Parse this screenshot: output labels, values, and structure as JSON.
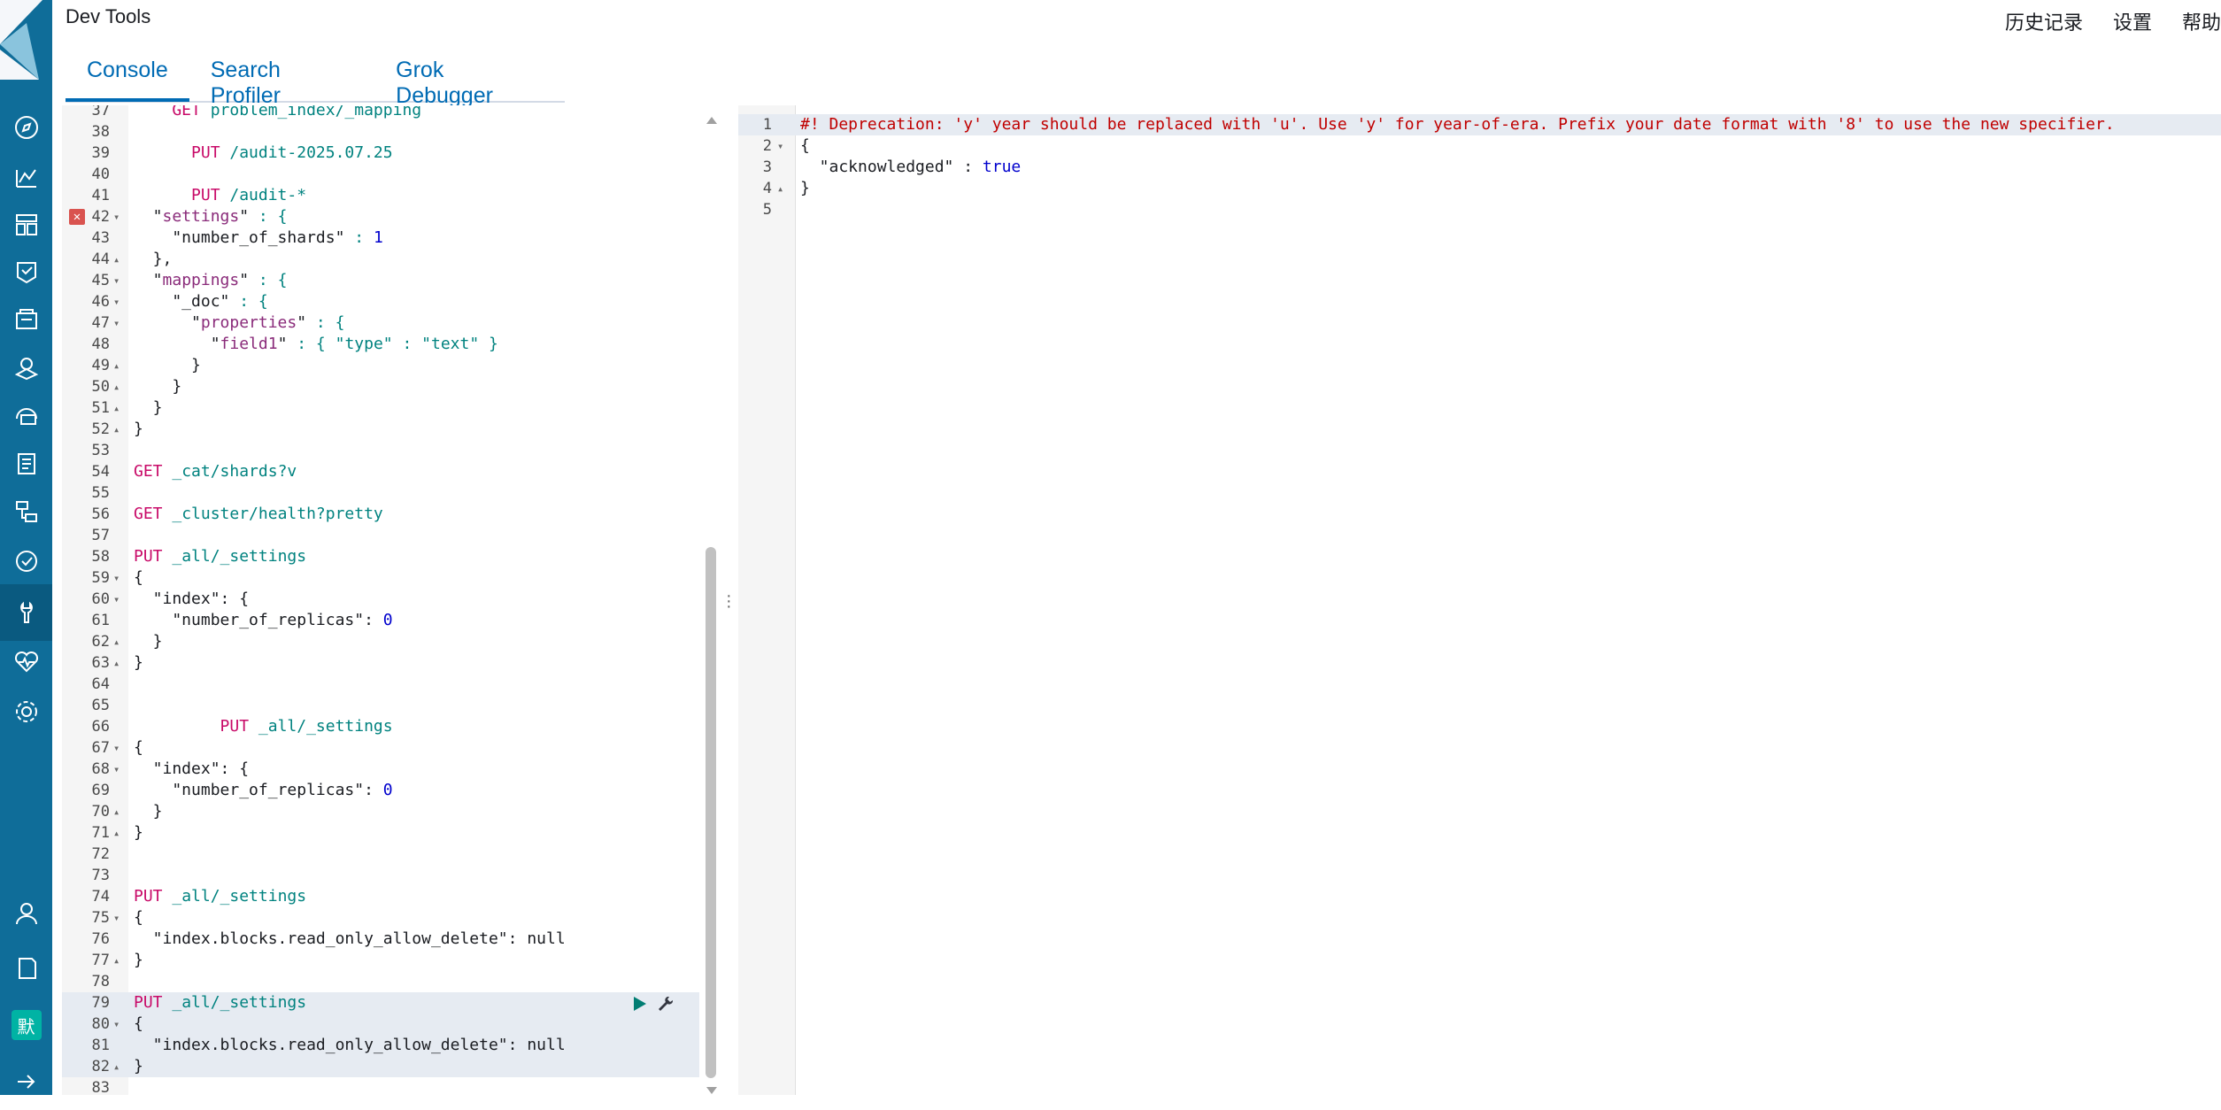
{
  "header": {
    "title": "Dev Tools",
    "links": [
      "历史记录",
      "设置",
      "帮助"
    ]
  },
  "tabs": [
    {
      "label": "Console",
      "active": true
    },
    {
      "label": "Search Profiler",
      "active": false
    },
    {
      "label": "Grok Debugger",
      "active": false
    }
  ],
  "sidebar": {
    "items": [
      "compass",
      "visualize",
      "dashboard",
      "canvas",
      "maps",
      "ml",
      "infrastructure",
      "logs",
      "apm",
      "uptime",
      "dev-tools",
      "monitoring",
      "management"
    ],
    "user_badge": "默"
  },
  "editor": {
    "lines": [
      {
        "n": "37",
        "fold": "",
        "t": [
          [
            "m",
            "    GET "
          ],
          [
            "u",
            "problem_index/_mapping"
          ]
        ]
      },
      {
        "n": "38",
        "fold": "",
        "t": []
      },
      {
        "n": "39",
        "fold": "",
        "t": [
          [
            "m",
            "      PUT "
          ],
          [
            "u",
            "/audit-2025.07.25"
          ]
        ]
      },
      {
        "n": "40",
        "fold": "",
        "t": []
      },
      {
        "n": "41",
        "fold": "",
        "t": [
          [
            "m",
            "      PUT "
          ],
          [
            "u",
            "/audit-*"
          ]
        ]
      },
      {
        "n": "42",
        "fold": "▾",
        "err": true,
        "t": [
          [
            "b",
            "  \""
          ],
          [
            "k",
            "settings"
          ],
          [
            "b",
            "\""
          ],
          [
            "s",
            " : {"
          ]
        ]
      },
      {
        "n": "43",
        "fold": "",
        "t": [
          [
            "b",
            "    \"number_of_shards\""
          ],
          [
            "s",
            " : "
          ],
          [
            "n",
            "1"
          ]
        ]
      },
      {
        "n": "44",
        "fold": "▴",
        "t": [
          [
            "b",
            "  },"
          ]
        ]
      },
      {
        "n": "45",
        "fold": "▾",
        "t": [
          [
            "b",
            "  \""
          ],
          [
            "k",
            "mappings"
          ],
          [
            "b",
            "\""
          ],
          [
            "s",
            " : {"
          ]
        ]
      },
      {
        "n": "46",
        "fold": "▾",
        "t": [
          [
            "b",
            "    \"_doc\""
          ],
          [
            "s",
            " : {"
          ]
        ]
      },
      {
        "n": "47",
        "fold": "▾",
        "t": [
          [
            "b",
            "      \""
          ],
          [
            "k",
            "properties"
          ],
          [
            "b",
            "\""
          ],
          [
            "s",
            " : {"
          ]
        ]
      },
      {
        "n": "48",
        "fold": "",
        "t": [
          [
            "b",
            "        \""
          ],
          [
            "k",
            "field1"
          ],
          [
            "b",
            "\""
          ],
          [
            "s",
            " : { \"type\" : \"text\" }"
          ]
        ]
      },
      {
        "n": "49",
        "fold": "▴",
        "t": [
          [
            "b",
            "      }"
          ]
        ]
      },
      {
        "n": "50",
        "fold": "▴",
        "t": [
          [
            "b",
            "    }"
          ]
        ]
      },
      {
        "n": "51",
        "fold": "▴",
        "t": [
          [
            "b",
            "  }"
          ]
        ]
      },
      {
        "n": "52",
        "fold": "▴",
        "t": [
          [
            "b",
            "}"
          ]
        ]
      },
      {
        "n": "53",
        "fold": "",
        "t": []
      },
      {
        "n": "54",
        "fold": "",
        "t": [
          [
            "m",
            "GET "
          ],
          [
            "u",
            "_cat/shards?v"
          ]
        ]
      },
      {
        "n": "55",
        "fold": "",
        "t": []
      },
      {
        "n": "56",
        "fold": "",
        "t": [
          [
            "m",
            "GET "
          ],
          [
            "u",
            "_cluster/health?pretty"
          ]
        ]
      },
      {
        "n": "57",
        "fold": "",
        "t": []
      },
      {
        "n": "58",
        "fold": "",
        "t": [
          [
            "m",
            "PUT "
          ],
          [
            "u",
            "_all/_settings"
          ]
        ]
      },
      {
        "n": "59",
        "fold": "▾",
        "t": [
          [
            "b",
            "{"
          ]
        ]
      },
      {
        "n": "60",
        "fold": "▾",
        "t": [
          [
            "b",
            "  \"index\": {"
          ]
        ]
      },
      {
        "n": "61",
        "fold": "",
        "t": [
          [
            "b",
            "    \"number_of_replicas\": "
          ],
          [
            "n",
            "0"
          ]
        ]
      },
      {
        "n": "62",
        "fold": "▴",
        "t": [
          [
            "b",
            "  }"
          ]
        ]
      },
      {
        "n": "63",
        "fold": "▴",
        "t": [
          [
            "b",
            "}"
          ]
        ]
      },
      {
        "n": "64",
        "fold": "",
        "t": []
      },
      {
        "n": "65",
        "fold": "",
        "t": []
      },
      {
        "n": "66",
        "fold": "",
        "t": [
          [
            "m",
            "         PUT "
          ],
          [
            "u",
            "_all/_settings"
          ]
        ]
      },
      {
        "n": "67",
        "fold": "▾",
        "t": [
          [
            "b",
            "{"
          ]
        ]
      },
      {
        "n": "68",
        "fold": "▾",
        "t": [
          [
            "b",
            "  \"index\": {"
          ]
        ]
      },
      {
        "n": "69",
        "fold": "",
        "t": [
          [
            "b",
            "    \"number_of_replicas\": "
          ],
          [
            "n",
            "0"
          ]
        ]
      },
      {
        "n": "70",
        "fold": "▴",
        "t": [
          [
            "b",
            "  }"
          ]
        ]
      },
      {
        "n": "71",
        "fold": "▴",
        "t": [
          [
            "b",
            "}"
          ]
        ]
      },
      {
        "n": "72",
        "fold": "",
        "t": []
      },
      {
        "n": "73",
        "fold": "",
        "t": []
      },
      {
        "n": "74",
        "fold": "",
        "t": [
          [
            "m",
            "PUT "
          ],
          [
            "u",
            "_all/_settings"
          ]
        ]
      },
      {
        "n": "75",
        "fold": "▾",
        "t": [
          [
            "b",
            "{"
          ]
        ]
      },
      {
        "n": "76",
        "fold": "",
        "t": [
          [
            "b",
            "  \"index.blocks.read_only_allow_delete\": null"
          ]
        ]
      },
      {
        "n": "77",
        "fold": "▴",
        "t": [
          [
            "b",
            "}"
          ]
        ]
      },
      {
        "n": "78",
        "fold": "",
        "t": []
      },
      {
        "n": "79",
        "fold": "",
        "hl": true,
        "actions": true,
        "t": [
          [
            "m",
            "PUT "
          ],
          [
            "u",
            "_all/_settings"
          ]
        ]
      },
      {
        "n": "80",
        "fold": "▾",
        "hl": true,
        "t": [
          [
            "b",
            "{"
          ]
        ]
      },
      {
        "n": "81",
        "fold": "",
        "hl": true,
        "t": [
          [
            "b",
            "  \"index.blocks.read_only_allow_delete\": null"
          ]
        ]
      },
      {
        "n": "82",
        "fold": "▴",
        "hl": true,
        "t": [
          [
            "b",
            "}"
          ]
        ]
      },
      {
        "n": "83",
        "fold": "",
        "t": []
      }
    ]
  },
  "output": {
    "lines": [
      {
        "n": "1",
        "fold": "",
        "warn": true,
        "t": [
          [
            "w",
            "#! Deprecation: 'y' year should be replaced with 'u'. Use 'y' for year-of-era. Prefix your date format with '8' to use the new specifier."
          ]
        ]
      },
      {
        "n": "2",
        "fold": "▾",
        "t": [
          [
            "b",
            "{"
          ]
        ]
      },
      {
        "n": "3",
        "fold": "",
        "t": [
          [
            "b",
            "  \"acknowledged\" : "
          ],
          [
            "n",
            "true"
          ]
        ]
      },
      {
        "n": "4",
        "fold": "▴",
        "t": [
          [
            "b",
            "}"
          ]
        ]
      },
      {
        "n": "5",
        "fold": "",
        "t": []
      }
    ]
  },
  "colors": {
    "sidebar": "#0f6d99",
    "tab_active": "#006bb4",
    "method": "#c80a68",
    "url": "#00827f"
  }
}
